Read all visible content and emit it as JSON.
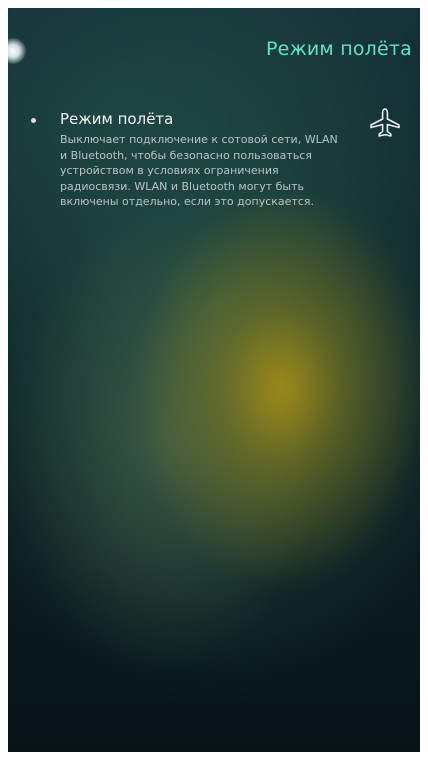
{
  "header": {
    "title": "Режим полёта"
  },
  "airplane_mode": {
    "title": "Режим полёта",
    "description": "Выключает подключение к сотовой сети, WLAN и Bluetooth, чтобы безопасно пользоваться устройством в условиях ограничения радиосвязи. WLAN и Bluetooth могут быть включены отдельно, если это допускается.",
    "icon": "airplane-icon"
  },
  "colors": {
    "accent": "#63e1c8",
    "title_text": "#f2f4f4",
    "description_text": "#b9c4c4"
  }
}
